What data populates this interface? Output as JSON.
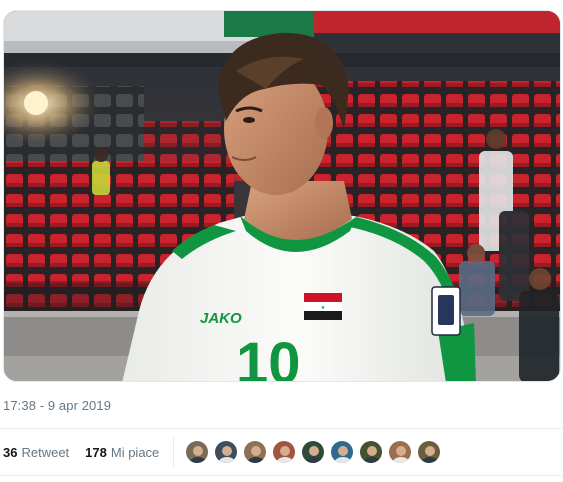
{
  "tweet": {
    "timestamp": "17:38 - 9 apr 2019",
    "photo": {
      "jersey_brand": "JAKO",
      "jersey_number": "10",
      "colors": {
        "jersey": "#f7f8f5",
        "trim": "#109640",
        "seats": "#c9242d"
      }
    },
    "stats": {
      "retweets_count": "36",
      "retweets_label": "Retweet",
      "likes_count": "178",
      "likes_label": "Mi piace"
    },
    "likers": [
      {
        "name": "liker-1",
        "color": "#7a6a58"
      },
      {
        "name": "liker-2",
        "color": "#3d4e5e"
      },
      {
        "name": "liker-3",
        "color": "#8c7356"
      },
      {
        "name": "liker-4",
        "color": "#a0553e"
      },
      {
        "name": "liker-5",
        "color": "#2f4a39"
      },
      {
        "name": "liker-6",
        "color": "#2d6a8f"
      },
      {
        "name": "liker-7",
        "color": "#41532f"
      },
      {
        "name": "liker-8",
        "color": "#9a6e4e"
      },
      {
        "name": "liker-9",
        "color": "#6b5e3a"
      }
    ]
  }
}
